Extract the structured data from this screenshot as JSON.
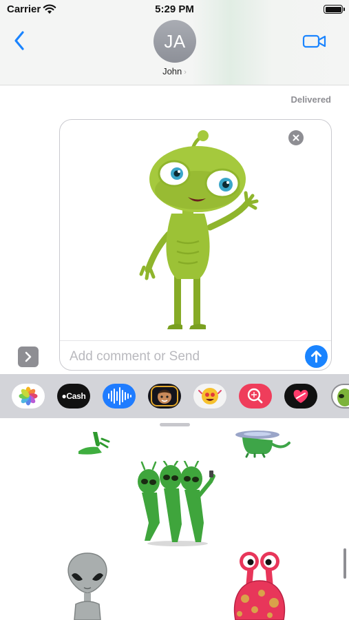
{
  "status_bar": {
    "carrier": "Carrier",
    "time": "5:29 PM"
  },
  "header": {
    "avatar_initials": "JA",
    "contact_name": "John",
    "contact_chevron": "›",
    "back_icon": "chevron-left-icon",
    "video_icon": "video-camera-icon"
  },
  "message": {
    "status": "Delivered"
  },
  "compose": {
    "placeholder": "Add comment or Send",
    "sticker": "waving green alien sticker"
  },
  "app_drawer": {
    "apps": [
      {
        "name": "Photos",
        "icon": "photos-icon"
      },
      {
        "name": "Apple Cash",
        "label": "Cash",
        "icon": "apple-cash-icon"
      },
      {
        "name": "Audio",
        "icon": "audio-waveform-icon"
      },
      {
        "name": "Memoji",
        "icon": "memoji-icon"
      },
      {
        "name": "Animoji",
        "icon": "animoji-icon"
      },
      {
        "name": "Images",
        "icon": "image-search-icon"
      },
      {
        "name": "Digital Touch",
        "icon": "heart-touch-icon"
      },
      {
        "name": "Alien Stickers",
        "icon": "alien-sticker-app-icon"
      }
    ]
  },
  "sticker_sheet": {
    "stickers": [
      {
        "name": "alien-feet-sticker"
      },
      {
        "name": "ufo-alien-sticker"
      },
      {
        "name": "alien-group-selfie-sticker"
      },
      {
        "name": "grey-alien-sticker"
      },
      {
        "name": "pink-spotted-monster-sticker"
      }
    ]
  },
  "colors": {
    "accent": "#1a84ff",
    "alien_green": "#9cc236",
    "monster_pink": "#e8365a"
  }
}
